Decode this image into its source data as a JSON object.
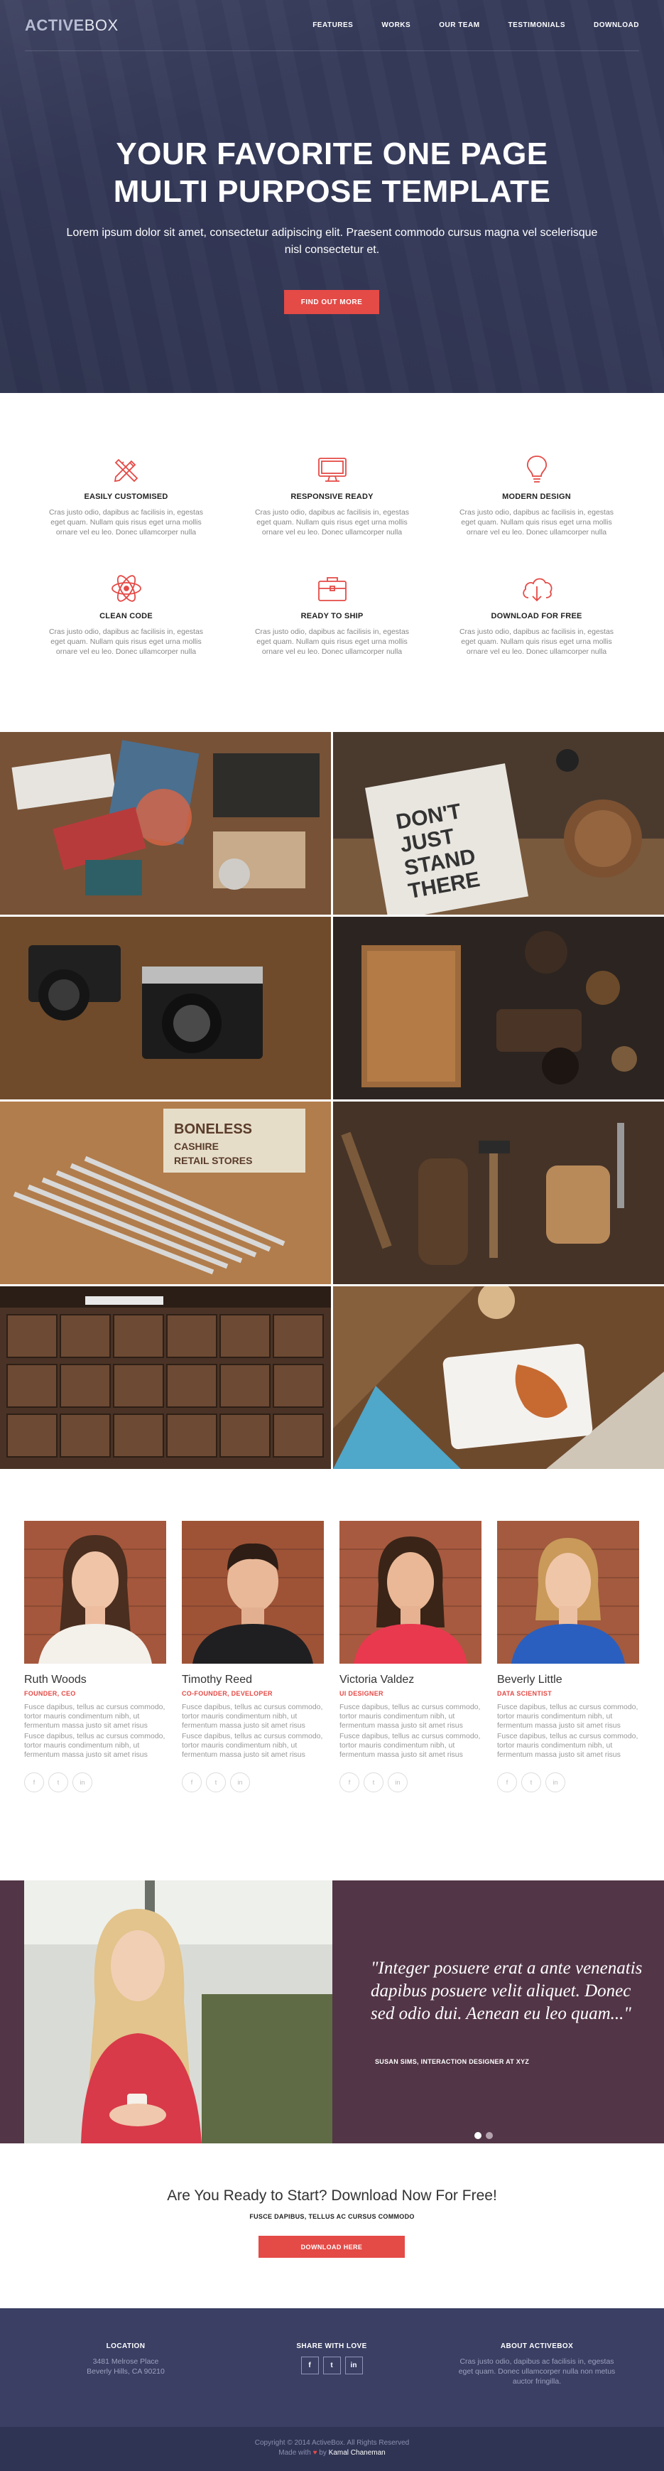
{
  "nav": {
    "logo_part1": "ACTIVE",
    "logo_part2": "BOX",
    "links": [
      "FEATURES",
      "WORKS",
      "OUR TEAM",
      "TESTIMONIALS",
      "DOWNLOAD"
    ]
  },
  "hero": {
    "title_line1": "YOUR FAVORITE ONE PAGE",
    "title_line2": "MULTI PURPOSE TEMPLATE",
    "subtitle": "Lorem ipsum dolor sit amet, consectetur adipiscing elit. Praesent commodo cursus magna vel scelerisque nisl consectetur et.",
    "button_label": "FIND OUT MORE"
  },
  "features": [
    {
      "title": "EASILY CUSTOMISED",
      "icon": "pencil-ruler-icon",
      "desc": "Cras justo odio, dapibus ac facilisis in, egestas eget quam. Nullam quis risus eget urna mollis ornare vel eu leo. Donec ullamcorper nulla"
    },
    {
      "title": "RESPONSIVE READY",
      "icon": "monitor-icon",
      "desc": "Cras justo odio, dapibus ac facilisis in, egestas eget quam. Nullam quis risus eget urna mollis ornare vel eu leo. Donec ullamcorper nulla"
    },
    {
      "title": "MODERN DESIGN",
      "icon": "lightbulb-icon",
      "desc": "Cras justo odio, dapibus ac facilisis in, egestas eget quam. Nullam quis risus eget urna mollis ornare vel eu leo. Donec ullamcorper nulla"
    },
    {
      "title": "CLEAN CODE",
      "icon": "atom-icon",
      "desc": "Cras justo odio, dapibus ac facilisis in, egestas eget quam. Nullam quis risus eget urna mollis ornare vel eu leo. Donec ullamcorper nulla"
    },
    {
      "title": "READY TO SHIP",
      "icon": "briefcase-icon",
      "desc": "Cras justo odio, dapibus ac facilisis in, egestas eget quam. Nullam quis risus eget urna mollis ornare vel eu leo. Donec ullamcorper nulla"
    },
    {
      "title": "DOWNLOAD FOR FREE",
      "icon": "cloud-download-icon",
      "desc": "Cras justo odio, dapibus ac facilisis in, egestas eget quam. Nullam quis risus eget urna mollis ornare vel eu leo. Donec ullamcorper nulla"
    }
  ],
  "gallery": {
    "tile2_text": [
      "DON'T",
      "JUST",
      "STAND",
      "THERE"
    ],
    "tile5_text": [
      "BONELESS",
      "CASHIRE",
      "RETAIL STORES"
    ]
  },
  "team": [
    {
      "name": "Ruth Woods",
      "role": "FOUNDER, CEO",
      "bio1": "Fusce dapibus, tellus ac cursus commodo, tortor mauris condimentum nibh, ut fermentum massa justo sit amet risus",
      "bio2": "Fusce dapibus, tellus ac cursus commodo, tortor mauris condimentum nibh, ut fermentum massa justo sit amet risus"
    },
    {
      "name": "Timothy Reed",
      "role": "CO-FOUNDER, DEVELOPER",
      "bio1": "Fusce dapibus, tellus ac cursus commodo, tortor mauris condimentum nibh, ut fermentum massa justo sit amet risus",
      "bio2": "Fusce dapibus, tellus ac cursus commodo, tortor mauris condimentum nibh, ut fermentum massa justo sit amet risus"
    },
    {
      "name": "Victoria Valdez",
      "role": "UI DESIGNER",
      "bio1": "Fusce dapibus, tellus ac cursus commodo, tortor mauris condimentum nibh, ut fermentum massa justo sit amet risus",
      "bio2": "Fusce dapibus, tellus ac cursus commodo, tortor mauris condimentum nibh, ut fermentum massa justo sit amet risus"
    },
    {
      "name": "Beverly Little",
      "role": "DATA SCIENTIST",
      "bio1": "Fusce dapibus, tellus ac cursus commodo, tortor mauris condimentum nibh, ut fermentum massa justo sit amet risus",
      "bio2": "Fusce dapibus, tellus ac cursus commodo, tortor mauris condimentum nibh, ut fermentum massa justo sit amet risus"
    }
  ],
  "social_glyphs": {
    "facebook": "f",
    "twitter": "t",
    "linkedin": "in"
  },
  "testimonial": {
    "quote": "\"Integer posuere erat a ante venenatis dapibus posuere velit aliquet. Donec sed odio dui. Aenean eu leo quam...\"",
    "author": "SUSAN SIMS, INTERACTION DESIGNER AT XYZ"
  },
  "cta": {
    "title": "Are You Ready to Start? Download Now For Free!",
    "subtitle": "FUSCE DAPIBUS, TELLUS AC CURSUS COMMODO",
    "button_label": "DOWNLOAD HERE"
  },
  "footer": {
    "location_title": "LOCATION",
    "location_line1": "3481 Melrose Place",
    "location_line2": "Beverly Hills, CA 90210",
    "share_title": "SHARE WITH LOVE",
    "about_title": "ABOUT ACTIVEBOX",
    "about_text": "Cras justo odio, dapibus ac facilisis in, egestas eget quam. Donec ullamcorper nulla non metus auctor fringilla.",
    "copyright": "Copyright © 2014 ActiveBox. All Rights Reserved",
    "made_with": "Made with",
    "made_by": "by",
    "author": "Kamal Chaneman"
  },
  "colors": {
    "accent": "#e44a46",
    "hero_bg": "#353a5a",
    "testimonial_bg": "#523547",
    "footer_bg": "#3a3f63"
  }
}
